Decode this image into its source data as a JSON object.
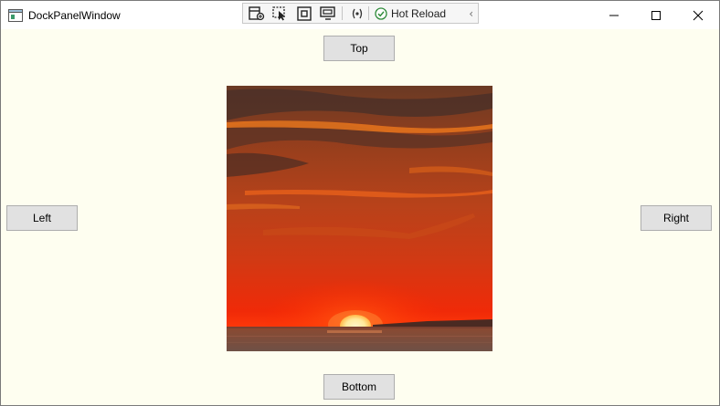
{
  "window": {
    "title": "DockPanelWindow"
  },
  "devtools": {
    "icons": [
      "live-visual-tree-icon",
      "select-element-icon",
      "display-layout-adorners-icon",
      "track-focus-icon",
      "binding-failures-icon"
    ],
    "hot_reload_label": "Hot Reload",
    "hot_reload_status_color": "#2e8b3a"
  },
  "buttons": {
    "top": "Top",
    "left": "Left",
    "right": "Right",
    "bottom": "Bottom"
  },
  "image": {
    "subject": "sunset over the sea"
  },
  "colors": {
    "client_background": "#fefef0",
    "button_background": "#e1e1e1",
    "button_border": "#adadad"
  }
}
